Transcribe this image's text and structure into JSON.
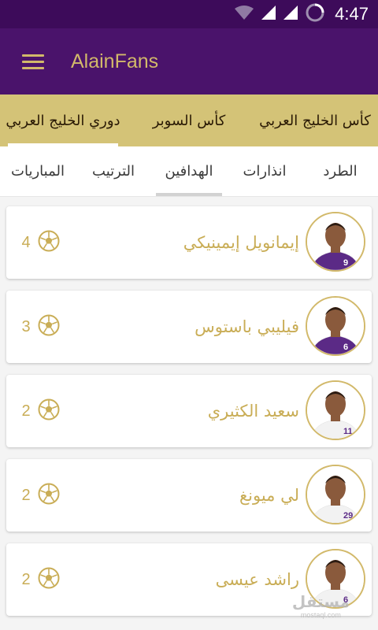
{
  "status_bar": {
    "time": "4:47"
  },
  "app_bar": {
    "title": "AlainFans"
  },
  "competition_tabs": [
    {
      "label": "كأس الخليج العربي",
      "active": false
    },
    {
      "label": "كأس السوبر",
      "active": false
    },
    {
      "label": "دوري الخليج العربي",
      "active": true
    }
  ],
  "sub_tabs": [
    {
      "label": "الطرد",
      "active": false
    },
    {
      "label": "انذارات",
      "active": false
    },
    {
      "label": "الهدافين",
      "active": true
    },
    {
      "label": "الترتيب",
      "active": false
    },
    {
      "label": "المباريات",
      "active": false
    }
  ],
  "scorers": [
    {
      "name": "إيمانويل إيمينيكي",
      "goals": "4",
      "shirt": "9",
      "kit": "#5b2a86"
    },
    {
      "name": "فيليبي باستوس",
      "goals": "3",
      "shirt": "6",
      "kit": "#5b2a86"
    },
    {
      "name": "سعيد الكثيري",
      "goals": "2",
      "shirt": "11",
      "kit": "#f2f2f2"
    },
    {
      "name": "لي ميونغ",
      "goals": "2",
      "shirt": "29",
      "kit": "#f2f2f2"
    },
    {
      "name": "راشد عيسى",
      "goals": "2",
      "shirt": "6",
      "kit": "#f2f2f2"
    }
  ],
  "watermark": {
    "line1": "مستقل",
    "line2": "mostaql.com"
  },
  "colors": {
    "status": "#3d0b5a",
    "appbar": "#4a136b",
    "gold": "#d2b96a",
    "tabs_bg": "#d4c377",
    "text_gold": "#c9ad56"
  }
}
